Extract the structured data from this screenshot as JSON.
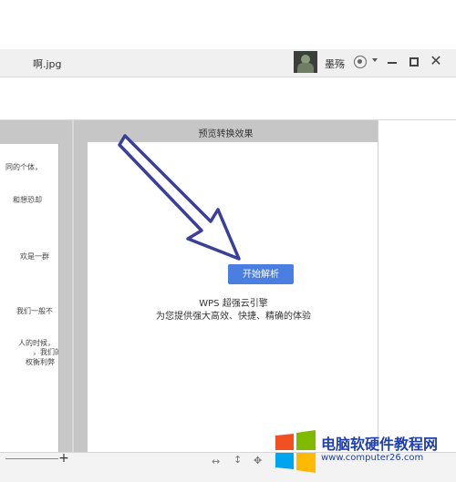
{
  "window": {
    "file_name": "啊.jpg",
    "user_name": "墨殇"
  },
  "document": {
    "lines": [
      "同的个体，",
      "和想恐却",
      "欢是一群",
      "我们一般不",
      "人的时候，",
      "，我们的",
      "权衡利弊"
    ]
  },
  "preview": {
    "title": "预览转换效果",
    "start_button": "开始解析",
    "engine_title": "WPS 超强云引擎",
    "engine_desc": "为您提供强大高效、快捷、精确的体验"
  },
  "bottom": {
    "zoom_in": "+"
  },
  "watermark": {
    "title": "电脑软硬件教程网",
    "url": "www.computer26.com"
  },
  "colors": {
    "accent_button": "#4a7ee0",
    "arrow": "#3a3f9a",
    "watermark_text": "#1f3fae"
  }
}
